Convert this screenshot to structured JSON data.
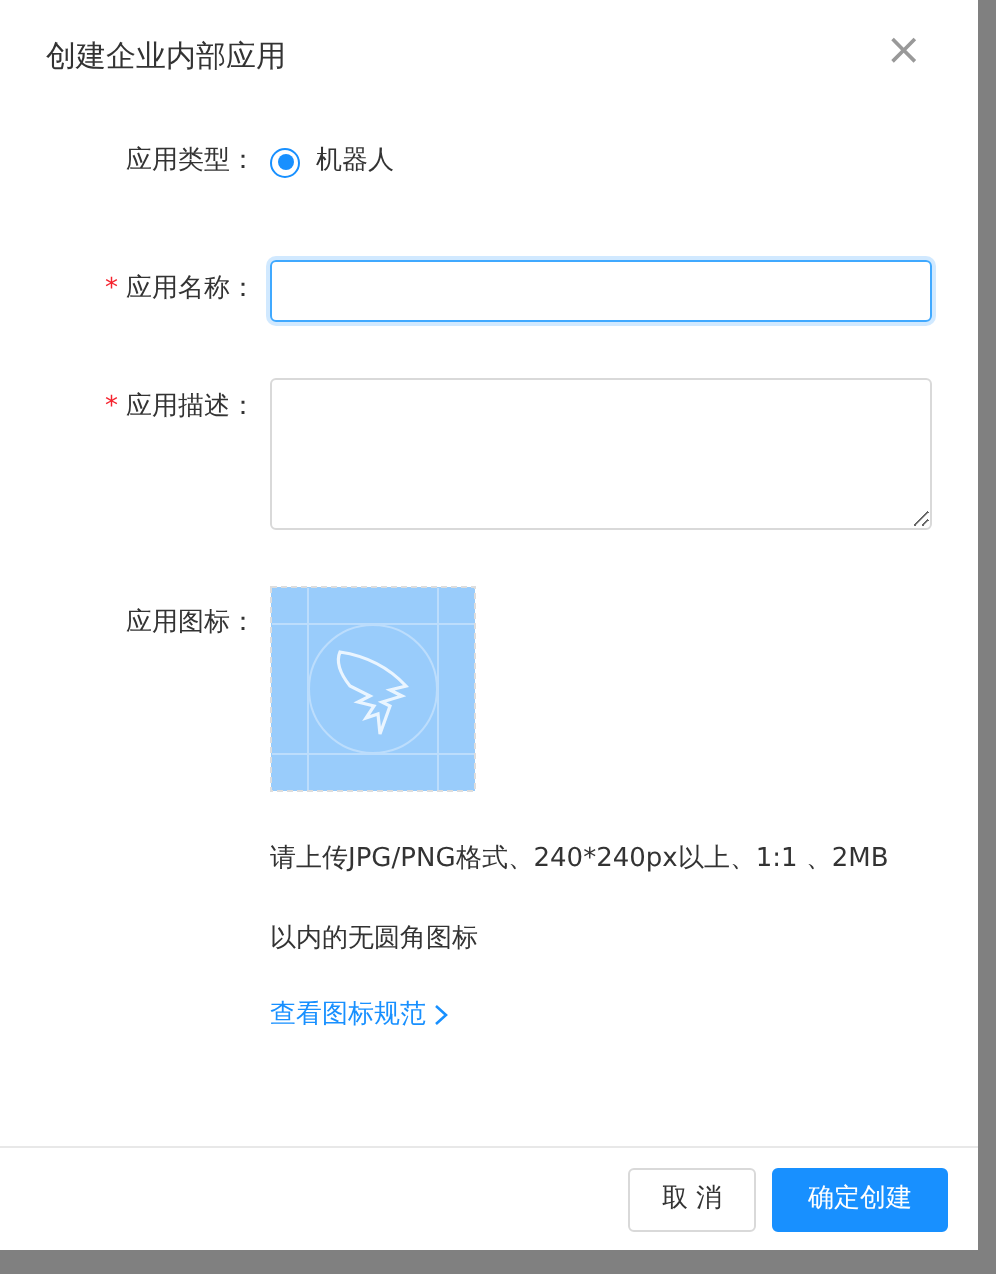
{
  "dialog": {
    "title": "创建企业内部应用",
    "close": "×"
  },
  "type_field": {
    "label": "应用类型：",
    "options": [
      {
        "label": "机器人",
        "selected": true
      }
    ]
  },
  "name_field": {
    "label": "应用名称：",
    "required": true
  },
  "description_field": {
    "label": "应用描述：",
    "required": true
  },
  "icon_field": {
    "label": "应用图标：",
    "hint": "请上传JPG/PNG格式、240*240px以上、1:1 、2MB以内的无圆角图标",
    "link": "查看图标规范"
  },
  "required_mark": "*",
  "buttons": [
    {
      "label": "取 消",
      "kind": "secondary"
    },
    {
      "label": "确定创建",
      "kind": "primary"
    }
  ]
}
